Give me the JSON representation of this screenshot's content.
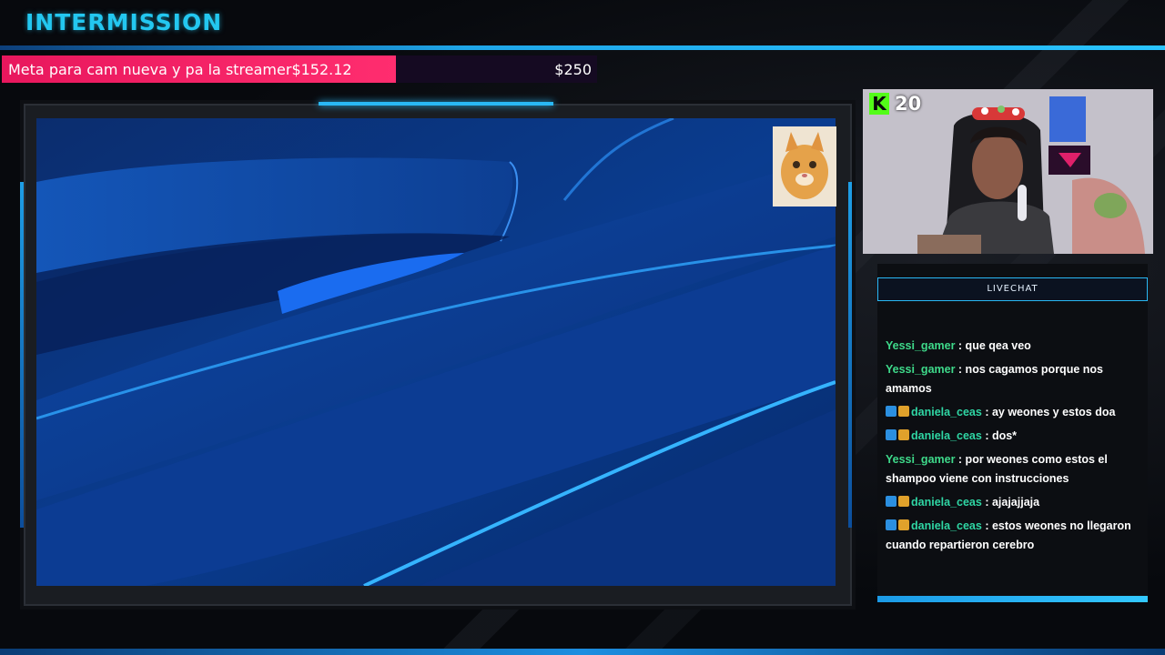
{
  "header": {
    "title": "INTERMISSION"
  },
  "goal": {
    "label": "Meta para cam nueva y pa la streamer",
    "current": "$152.12",
    "target": "$250",
    "progress_fraction": 0.6085
  },
  "streamer": {
    "viewer_count": "20",
    "platform_icon": "kick-icon",
    "platform_letter": "K"
  },
  "chat": {
    "header": "LIVECHAT",
    "messages": [
      {
        "user": "Yessi_gamer",
        "text": " : que qea veo",
        "badges": []
      },
      {
        "user": "Yessi_gamer",
        "text": " : nos cagamos porque nos amamos",
        "badges": []
      },
      {
        "user": "daniela_ceas",
        "text": " : ay weones y estos doa",
        "badges": [
          "blue",
          "gold"
        ]
      },
      {
        "user": "daniela_ceas",
        "text": " : dos*",
        "badges": [
          "blue",
          "gold"
        ]
      },
      {
        "user": "Yessi_gamer",
        "text": " : por weones como estos el shampoo viene con instrucciones",
        "badges": []
      },
      {
        "user": "daniela_ceas",
        "text": " : ajajajjaja",
        "badges": [
          "blue",
          "gold"
        ]
      },
      {
        "user": "daniela_ceas",
        "text": " : estos weones no llegaron cuando repartieron cerebro",
        "badges": [
          "blue",
          "gold"
        ]
      }
    ]
  },
  "colors": {
    "accent": "#23c7f0",
    "goal_fill": "#e8175d",
    "kick_green": "#53fc18",
    "user_green": "#3ed98a"
  }
}
